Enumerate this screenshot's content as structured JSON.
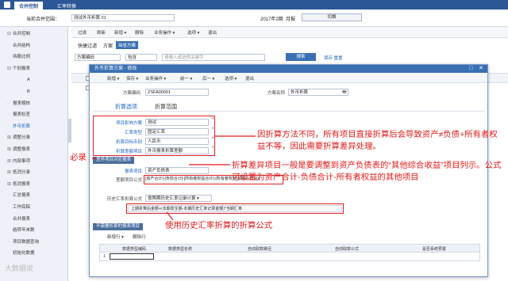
{
  "top": {
    "tab1": "合并控制",
    "tab2": "汇率转换"
  },
  "filter": {
    "scope_label": "当前合并范围：",
    "scope_value": "测试外币折算 01",
    "period_label": "2017年2期",
    "period_unit": "月报",
    "switch_btn": "切换"
  },
  "sidebar": {
    "items": [
      {
        "label": "合并控制",
        "indent": 0,
        "exp": "⊟"
      },
      {
        "label": "合并结构",
        "indent": 1
      },
      {
        "label": "持股比例",
        "indent": 1
      },
      {
        "label": "个别报表",
        "indent": 1,
        "exp": "⊟"
      },
      {
        "label": "A",
        "indent": 2
      },
      {
        "label": "B",
        "indent": 2
      },
      {
        "label": "报表稽核",
        "indent": 1
      },
      {
        "label": "报表检查",
        "indent": 1
      },
      {
        "label": "外币折算",
        "indent": 1,
        "active": true
      },
      {
        "label": "调整分录",
        "indent": 1,
        "exp": "⊞"
      },
      {
        "label": "调整报表",
        "indent": 1,
        "exp": "⊞"
      },
      {
        "label": "内部事项",
        "indent": 1,
        "exp": "⊞"
      },
      {
        "label": "抵消分录",
        "indent": 1,
        "exp": "⊞"
      },
      {
        "label": "抵消报表",
        "indent": 1,
        "exp": "⊞"
      },
      {
        "label": "汇总报表",
        "indent": 1
      },
      {
        "label": "工作底稿",
        "indent": 1
      },
      {
        "label": "合并报表",
        "indent": 1
      },
      {
        "label": "结转年末数",
        "indent": 1
      },
      {
        "label": "项目数据查询",
        "indent": 1
      },
      {
        "label": "初始化数据",
        "indent": 1
      }
    ]
  },
  "main": {
    "toolbar": [
      "过滤",
      "刷新",
      "新增 ▾",
      "删除",
      "业务操作 ▾",
      "选项 ▾",
      "退出"
    ],
    "quick_label": "快捷过滤",
    "scheme_label": "方案",
    "scheme_btn": "缺省方案",
    "field_value": "方案编码",
    "op_value": "包含",
    "search_placeholder": "请输入或选择关键字",
    "search_btn": "搜索",
    "save_link": "保存  重置"
  },
  "dialog": {
    "title": "外币折算方案 - 修改",
    "toolbar": [
      "新增 ▾",
      "保存 ▾",
      "业务操作 ▾",
      "前一 ▾",
      "后一 ▾",
      "选项 ▾",
      "退出"
    ],
    "code_label": "方案编码",
    "code_value": "ZSFA00001",
    "name_label": "方案名称",
    "name_value": "外币折算",
    "tab_active": "折算选项",
    "tab_other": "折算范围",
    "rows": [
      {
        "label": "项目影响方案",
        "value": "测试"
      },
      {
        "label": "汇率类型",
        "value": "固定汇率"
      },
      {
        "label": "折算目标币别",
        "value": "人民币"
      },
      {
        "label": "折算差额项目",
        "value": "外币报表折算差额"
      }
    ],
    "section1": "差异项目对应报表",
    "table_label": "报表项目",
    "table_value": "资产负债表",
    "diff_label": "差额项目公式",
    "diff_value": "[资产合计]-[负债合计]-[所有者权益合计]-[所有者权益(或股东权益)]",
    "hist_label": "历史汇率折算公式",
    "hist_value": "按照期历史汇率记录计算 ▾",
    "formula": "上期折算后金额+(本期发生额-本期历史汇率记录金额)*当期汇率",
    "section2": "不需要折算的报表项目",
    "sub_toolbar": [
      "新增行 ▾",
      "删除行"
    ],
    "sub_head": [
      "数据类型编码",
      "数据类型名称",
      "自动取数路径",
      "自动取数公式",
      "是否系统预置"
    ],
    "row_num": "1"
  },
  "annotations": {
    "a1": "因折算方法不同，所有项目直接折算后会导致资产≠负债+所有者权益不等，因此需要折算差异处理。",
    "a2": "折算差异项目一般是要调整到资产负债表的“其他综合收益”项目列示。公式可设置为资产合计-负债合计-所有者权益的其他项目",
    "a3": "必录",
    "a4": "使用历史汇率折算的折算公式"
  },
  "watermark": "大数据说"
}
